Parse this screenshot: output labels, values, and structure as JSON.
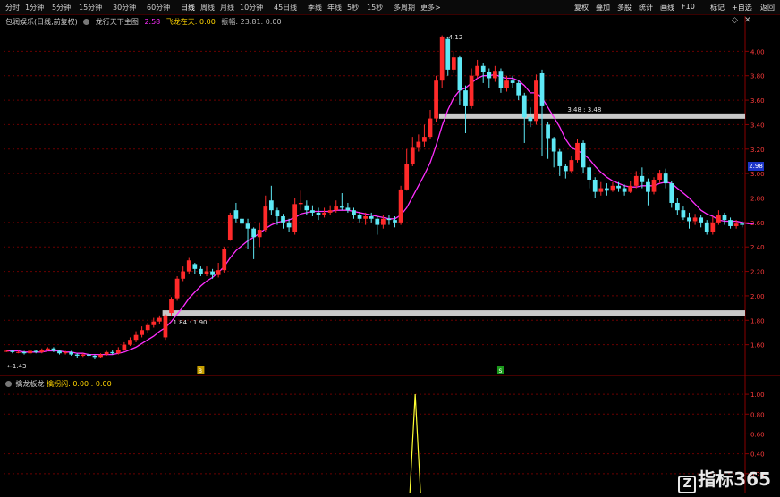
{
  "tabs": [
    "分时",
    "1分钟",
    "5分钟",
    "15分钟",
    "30分钟",
    "60分钟",
    "日线",
    "周线",
    "月线",
    "10分钟",
    "45日线",
    "季线",
    "年线",
    "5秒",
    "15秒",
    "多周期",
    "更多>"
  ],
  "active_tab": "日线",
  "right_tabs": [
    "复权",
    "叠加",
    "多股",
    "统计",
    "画线",
    "F10",
    "标记",
    "+自选",
    "返回"
  ],
  "legend": {
    "indicator": "包润娱乐(日线,前复权)",
    "name": "龙行天下主图",
    "value": "2.58",
    "flying_label": "飞龙在天: 0.00",
    "extra": "振幅: 23.81: 0.00"
  },
  "sub_legend": {
    "name": "擒龙板龙",
    "text": "擒拐闪: 0.00 : 0.00"
  },
  "marker_labels": {
    "b": "B",
    "s": "S"
  },
  "price_tag": "2.98",
  "watermark": "指标365",
  "colors": {
    "up": "#ff2a2a",
    "down": "#5ee8f5",
    "ma": "#ff2fff",
    "band": "#c8c8c8",
    "grid": "#6a0000",
    "axis": "#8a0000",
    "spike": "#ffff33"
  },
  "chart_data": {
    "type": "candlestick",
    "ylim": [
      1.4,
      4.2
    ],
    "yticks": [
      4.0,
      3.8,
      3.6,
      3.4,
      3.2,
      3.0,
      2.8,
      2.6,
      2.4,
      2.2,
      2.0,
      1.8,
      1.6
    ],
    "annotations": {
      "high_label": "4.12",
      "low_label": "1.43",
      "band_upper_label": "3.48 : 3.48",
      "band_lower_label": "1.84 : 1.90"
    },
    "bands": [
      {
        "y": 3.47,
        "x_start": 74
      },
      {
        "y": 1.86,
        "x_start": 27
      }
    ],
    "candles": [
      [
        1.55,
        1.55,
        1.56,
        1.54
      ],
      [
        1.55,
        1.54,
        1.56,
        1.53
      ],
      [
        1.54,
        1.54,
        1.55,
        1.53
      ],
      [
        1.54,
        1.53,
        1.55,
        1.52
      ],
      [
        1.53,
        1.55,
        1.56,
        1.52
      ],
      [
        1.55,
        1.54,
        1.56,
        1.53
      ],
      [
        1.54,
        1.56,
        1.57,
        1.53
      ],
      [
        1.56,
        1.57,
        1.58,
        1.55
      ],
      [
        1.57,
        1.55,
        1.58,
        1.54
      ],
      [
        1.55,
        1.53,
        1.56,
        1.52
      ],
      [
        1.53,
        1.54,
        1.55,
        1.52
      ],
      [
        1.54,
        1.52,
        1.55,
        1.51
      ],
      [
        1.52,
        1.51,
        1.53,
        1.49
      ],
      [
        1.51,
        1.52,
        1.53,
        1.5
      ],
      [
        1.52,
        1.51,
        1.53,
        1.5
      ],
      [
        1.51,
        1.5,
        1.52,
        1.48
      ],
      [
        1.5,
        1.52,
        1.53,
        1.49
      ],
      [
        1.52,
        1.54,
        1.55,
        1.51
      ],
      [
        1.54,
        1.53,
        1.56,
        1.52
      ],
      [
        1.53,
        1.56,
        1.58,
        1.52
      ],
      [
        1.56,
        1.6,
        1.62,
        1.55
      ],
      [
        1.6,
        1.64,
        1.66,
        1.59
      ],
      [
        1.64,
        1.68,
        1.71,
        1.62
      ],
      [
        1.68,
        1.72,
        1.75,
        1.66
      ],
      [
        1.72,
        1.76,
        1.78,
        1.7
      ],
      [
        1.76,
        1.79,
        1.82,
        1.74
      ],
      [
        1.79,
        1.82,
        1.84,
        1.77
      ],
      [
        1.66,
        1.84,
        1.85,
        1.64
      ],
      [
        1.86,
        1.97,
        1.99,
        1.84
      ],
      [
        1.98,
        2.14,
        2.16,
        1.96
      ],
      [
        2.14,
        2.2,
        2.24,
        2.12
      ],
      [
        2.2,
        2.29,
        2.31,
        2.18
      ],
      [
        2.26,
        2.22,
        2.27,
        2.18
      ],
      [
        2.22,
        2.18,
        2.24,
        2.16
      ],
      [
        2.18,
        2.2,
        2.24,
        2.16
      ],
      [
        2.2,
        2.17,
        2.22,
        2.14
      ],
      [
        2.17,
        2.21,
        2.27,
        2.15
      ],
      [
        2.21,
        2.38,
        2.4,
        2.19
      ],
      [
        2.46,
        2.66,
        2.68,
        2.45
      ],
      [
        2.7,
        2.63,
        2.76,
        2.6
      ],
      [
        2.63,
        2.59,
        2.64,
        2.55
      ],
      [
        2.59,
        2.55,
        2.63,
        2.38
      ],
      [
        2.55,
        2.48,
        2.56,
        2.3
      ],
      [
        2.48,
        2.54,
        2.6,
        2.4
      ],
      [
        2.54,
        2.73,
        2.82,
        2.52
      ],
      [
        2.78,
        2.7,
        2.9,
        2.66
      ],
      [
        2.7,
        2.65,
        2.72,
        2.58
      ],
      [
        2.65,
        2.6,
        2.67,
        2.55
      ],
      [
        2.6,
        2.56,
        2.63,
        2.52
      ],
      [
        2.52,
        2.75,
        2.8,
        2.5
      ],
      [
        2.75,
        2.76,
        2.86,
        2.7
      ],
      [
        2.74,
        2.7,
        2.78,
        2.66
      ],
      [
        2.7,
        2.68,
        2.74,
        2.65
      ],
      [
        2.68,
        2.66,
        2.72,
        2.62
      ],
      [
        2.66,
        2.68,
        2.72,
        2.64
      ],
      [
        2.68,
        2.7,
        2.74,
        2.66
      ],
      [
        2.7,
        2.73,
        2.78,
        2.68
      ],
      [
        2.73,
        2.72,
        2.84,
        2.7
      ],
      [
        2.72,
        2.7,
        2.76,
        2.68
      ],
      [
        2.7,
        2.66,
        2.72,
        2.63
      ],
      [
        2.66,
        2.63,
        2.68,
        2.6
      ],
      [
        2.63,
        2.65,
        2.68,
        2.58
      ],
      [
        2.65,
        2.63,
        2.68,
        2.6
      ],
      [
        2.63,
        2.58,
        2.65,
        2.5
      ],
      [
        2.58,
        2.63,
        2.66,
        2.55
      ],
      [
        2.63,
        2.62,
        2.66,
        2.58
      ],
      [
        2.62,
        2.6,
        2.65,
        2.56
      ],
      [
        2.6,
        2.87,
        2.9,
        2.58
      ],
      [
        2.87,
        3.08,
        3.2,
        2.86
      ],
      [
        3.08,
        3.21,
        3.3,
        3.06
      ],
      [
        3.21,
        3.26,
        3.32,
        3.18
      ],
      [
        3.26,
        3.3,
        3.4,
        3.22
      ],
      [
        3.3,
        3.45,
        3.52,
        3.28
      ],
      [
        3.45,
        3.76,
        3.8,
        3.42
      ],
      [
        3.76,
        4.12,
        4.13,
        3.7
      ],
      [
        4.1,
        3.85,
        4.12,
        3.8
      ],
      [
        3.85,
        3.95,
        4.0,
        3.82
      ],
      [
        3.95,
        3.68,
        3.96,
        3.56
      ],
      [
        3.68,
        3.55,
        3.72,
        3.33
      ],
      [
        3.55,
        3.8,
        3.86,
        3.53
      ],
      [
        3.8,
        3.88,
        3.93,
        3.78
      ],
      [
        3.88,
        3.83,
        3.9,
        3.74
      ],
      [
        3.83,
        3.78,
        3.86,
        3.7
      ],
      [
        3.78,
        3.84,
        3.88,
        3.75
      ],
      [
        3.84,
        3.7,
        3.86,
        3.66
      ],
      [
        3.7,
        3.76,
        3.8,
        3.67
      ],
      [
        3.76,
        3.74,
        3.8,
        3.7
      ],
      [
        3.74,
        3.64,
        3.76,
        3.6
      ],
      [
        3.64,
        3.46,
        3.66,
        3.25
      ],
      [
        3.46,
        3.43,
        3.54,
        3.38
      ],
      [
        3.43,
        3.76,
        3.81,
        3.4
      ],
      [
        3.82,
        3.55,
        3.85,
        3.14
      ],
      [
        3.4,
        3.29,
        3.42,
        3.12
      ],
      [
        3.29,
        3.18,
        3.3,
        3.05
      ],
      [
        3.18,
        3.06,
        3.2,
        2.98
      ],
      [
        3.06,
        3.02,
        3.08,
        2.96
      ],
      [
        3.02,
        3.11,
        3.14,
        3.0
      ],
      [
        3.11,
        3.25,
        3.28,
        3.09
      ],
      [
        3.25,
        3.05,
        3.27,
        3.0
      ],
      [
        3.05,
        2.95,
        3.07,
        2.88
      ],
      [
        2.95,
        2.85,
        2.97,
        2.8
      ],
      [
        2.85,
        2.88,
        2.93,
        2.82
      ],
      [
        2.88,
        2.86,
        2.92,
        2.82
      ],
      [
        2.86,
        2.9,
        2.93,
        2.85
      ],
      [
        2.9,
        2.88,
        2.93,
        2.85
      ],
      [
        2.88,
        2.85,
        2.91,
        2.82
      ],
      [
        2.85,
        2.9,
        2.94,
        2.84
      ],
      [
        2.9,
        2.98,
        3.02,
        2.88
      ],
      [
        2.98,
        2.93,
        3.05,
        2.88
      ],
      [
        2.93,
        2.85,
        2.96,
        2.74
      ],
      [
        2.85,
        2.95,
        2.97,
        2.83
      ],
      [
        2.95,
        3.0,
        3.03,
        2.92
      ],
      [
        3.0,
        2.92,
        3.04,
        2.88
      ],
      [
        2.92,
        2.76,
        2.94,
        2.72
      ],
      [
        2.76,
        2.7,
        2.8,
        2.66
      ],
      [
        2.7,
        2.64,
        2.73,
        2.62
      ],
      [
        2.64,
        2.61,
        2.68,
        2.55
      ],
      [
        2.61,
        2.64,
        2.67,
        2.58
      ],
      [
        2.64,
        2.6,
        2.66,
        2.56
      ],
      [
        2.6,
        2.52,
        2.62,
        2.5
      ],
      [
        2.52,
        2.6,
        2.65,
        2.5
      ],
      [
        2.6,
        2.66,
        2.7,
        2.58
      ],
      [
        2.66,
        2.62,
        2.68,
        2.58
      ],
      [
        2.62,
        2.57,
        2.64,
        2.55
      ],
      [
        2.57,
        2.59,
        2.62,
        2.55
      ],
      [
        2.59,
        2.58,
        2.61,
        2.56
      ]
    ],
    "ma": [
      1.55,
      1.55,
      1.55,
      1.54,
      1.54,
      1.54,
      1.54,
      1.55,
      1.55,
      1.55,
      1.54,
      1.54,
      1.53,
      1.53,
      1.52,
      1.52,
      1.52,
      1.52,
      1.52,
      1.53,
      1.54,
      1.56,
      1.58,
      1.61,
      1.64,
      1.67,
      1.71,
      1.74,
      1.79,
      1.85,
      1.91,
      1.98,
      2.03,
      2.08,
      2.12,
      2.15,
      2.19,
      2.24,
      2.31,
      2.37,
      2.41,
      2.45,
      2.48,
      2.51,
      2.55,
      2.58,
      2.6,
      2.61,
      2.62,
      2.64,
      2.67,
      2.68,
      2.69,
      2.69,
      2.69,
      2.69,
      2.7,
      2.7,
      2.7,
      2.69,
      2.68,
      2.67,
      2.66,
      2.65,
      2.64,
      2.63,
      2.63,
      2.66,
      2.72,
      2.81,
      2.9,
      2.99,
      3.09,
      3.23,
      3.39,
      3.52,
      3.62,
      3.68,
      3.7,
      3.74,
      3.78,
      3.8,
      3.8,
      3.81,
      3.79,
      3.78,
      3.78,
      3.76,
      3.72,
      3.66,
      3.66,
      3.62,
      3.54,
      3.46,
      3.38,
      3.28,
      3.21,
      3.19,
      3.16,
      3.12,
      3.06,
      3.01,
      2.97,
      2.94,
      2.92,
      2.9,
      2.89,
      2.89,
      2.9,
      2.9,
      2.9,
      2.92,
      2.93,
      2.92,
      2.88,
      2.84,
      2.8,
      2.75,
      2.7,
      2.67,
      2.65,
      2.62,
      2.61,
      2.61,
      2.61,
      2.6,
      2.59,
      2.59
    ],
    "markers": [
      {
        "index": 28,
        "label": "B"
      },
      {
        "index": 79,
        "label": "S"
      }
    ],
    "sub": {
      "ylim": [
        0,
        1.1
      ],
      "yticks": [
        1.0,
        0.8,
        0.6,
        0.4,
        0.2
      ],
      "spike_index": 55,
      "spike_value": 1.0
    }
  }
}
